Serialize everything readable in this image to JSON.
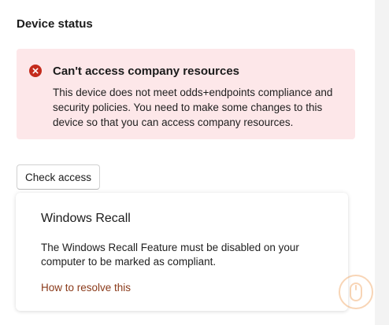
{
  "device_status": {
    "title": "Device status"
  },
  "alert": {
    "icon": "error-icon",
    "title": "Can't access company resources",
    "body": "This device does not meet odds+endpoints compliance and security policies. You need to make some changes to this device so that you can access company resources.",
    "background_color": "#fde7e9",
    "icon_color": "#c42b1c"
  },
  "actions": {
    "check_access_label": "Check access"
  },
  "issue_card": {
    "title": "Windows Recall",
    "description": "The Windows Recall Feature must be disabled on your computer to be marked as compliant.",
    "link_label": "How to resolve this",
    "link_color": "#8a3a1a"
  },
  "floating_icon": {
    "icon": "mouse-icon",
    "color": "#f0a35e"
  }
}
